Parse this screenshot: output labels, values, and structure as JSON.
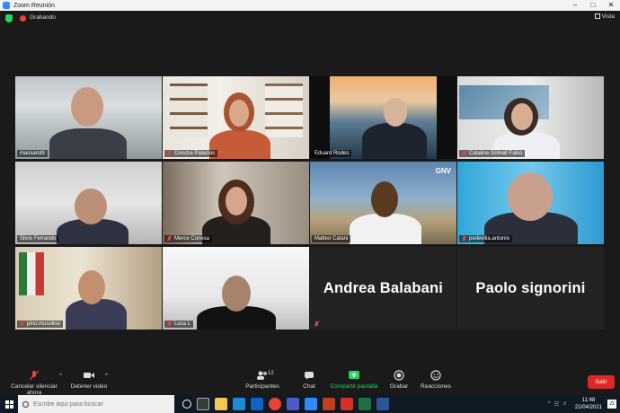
{
  "window": {
    "title": "Zoom Reunión"
  },
  "topbar": {
    "recording_label": "Grabando",
    "view_label": "Vista"
  },
  "participants": [
    {
      "name": "massarotti",
      "muted": false,
      "active": true
    },
    {
      "name": "Concha Palacios",
      "muted": true
    },
    {
      "name": "Eduard Rodes",
      "muted": false
    },
    {
      "name": "Catalina Grimalt Falcó",
      "muted": true
    },
    {
      "name": "Silvio Ferrando",
      "muted": false
    },
    {
      "name": "Merce Conesa",
      "muted": true
    },
    {
      "name": "Matteo Catani",
      "muted": false,
      "logo": "GNV"
    },
    {
      "name": "pedevilla.antonio",
      "muted": true
    },
    {
      "name": "pino.musolino",
      "muted": true
    },
    {
      "name": "Luca L",
      "muted": true
    },
    {
      "name": "Andrea Balabani",
      "muted": true,
      "video": false
    },
    {
      "name": "Paolo signorini",
      "muted": false,
      "video": false
    }
  ],
  "toolbar": {
    "mute_label": "Cancelar silenciar ahora",
    "video_label": "Detener video",
    "participants_label": "Participantes",
    "participants_count": "12",
    "chat_label": "Chat",
    "share_label": "Compartir pantalla",
    "record_label": "Grabar",
    "reactions_label": "Reacciones",
    "leave_label": "Salir"
  },
  "taskbar": {
    "search_placeholder": "Escribe aquí para buscar",
    "time": "11:48",
    "date": "21/04/2021",
    "notifications": "22"
  },
  "colors": {
    "active_speaker": "#b8e35a",
    "share_green": "#23d959",
    "leave_red": "#e02828"
  }
}
